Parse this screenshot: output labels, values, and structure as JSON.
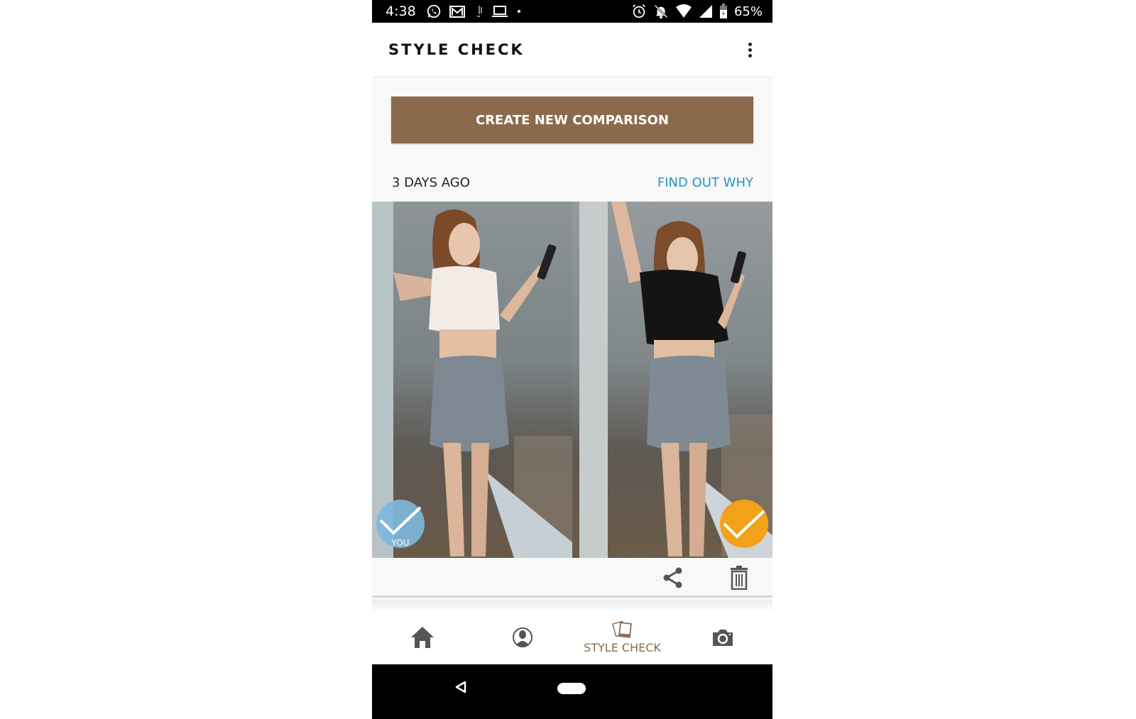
{
  "status_bar": {
    "time": "4:38",
    "left_icons": [
      "whatsapp-icon",
      "gmail-icon",
      "music-note-icon",
      "laptop-icon",
      "dot-icon"
    ],
    "right_icons": [
      "alarm-icon",
      "notifications-off-icon",
      "wifi-icon",
      "cell-signal-icon",
      "battery-charging-icon"
    ],
    "battery": "65%"
  },
  "app_bar": {
    "title": "STYLE CHECK",
    "menu_icon": "more-vert-icon"
  },
  "main": {
    "create_button_label": "CREATE NEW COMPARISON",
    "comparison": {
      "time_ago": "3 DAYS AGO",
      "find_out_link": "FIND OUT WHY",
      "photos": [
        {
          "description": "White ruffled crop top with gray skirt",
          "badge": "you-vote",
          "badge_label": "YOU",
          "badge_color": "#7db7dc"
        },
        {
          "description": "Black crop tee with gray skirt",
          "badge": "winner",
          "badge_label": "",
          "badge_color": "#f2a21a"
        }
      ],
      "actions": [
        "share-icon",
        "delete-icon"
      ]
    }
  },
  "bottom_nav": {
    "items": [
      {
        "icon": "home-icon",
        "label": "",
        "active": false
      },
      {
        "icon": "profile-icon",
        "label": "",
        "active": false
      },
      {
        "icon": "style-check-icon",
        "label": "STYLE CHECK",
        "active": true
      },
      {
        "icon": "camera-icon",
        "label": "",
        "active": false
      }
    ]
  },
  "colors": {
    "brand": "#8b6a4c",
    "link": "#2a93c4",
    "you_badge": "#7db7dc",
    "winner_badge": "#f2a21a"
  }
}
